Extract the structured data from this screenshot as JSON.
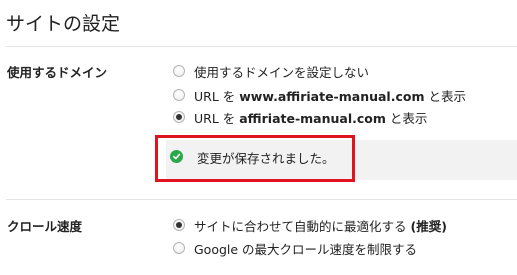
{
  "page": {
    "title": "サイトの設定"
  },
  "domain_section": {
    "label": "使用するドメイン",
    "options": [
      {
        "text": "使用するドメインを設定しない",
        "selected": false
      },
      {
        "prefix": "URL を ",
        "domain": "www.affiriate-manual.com",
        "suffix": " と表示",
        "selected": false
      },
      {
        "prefix": "URL を ",
        "domain": "affiriate-manual.com",
        "suffix": " と表示",
        "selected": true
      }
    ]
  },
  "notice": {
    "text": "変更が保存されました。",
    "icon": "check-circle-icon",
    "icon_color": "#2aa84a",
    "highlight_color": "#e0141e"
  },
  "crawl_section": {
    "label": "クロール速度",
    "options": [
      {
        "text": "サイトに合わせて自動的に最適化する ",
        "strong": "(推奨)",
        "selected": true
      },
      {
        "text": "Google の最大クロール速度を制限する",
        "selected": false
      }
    ]
  }
}
